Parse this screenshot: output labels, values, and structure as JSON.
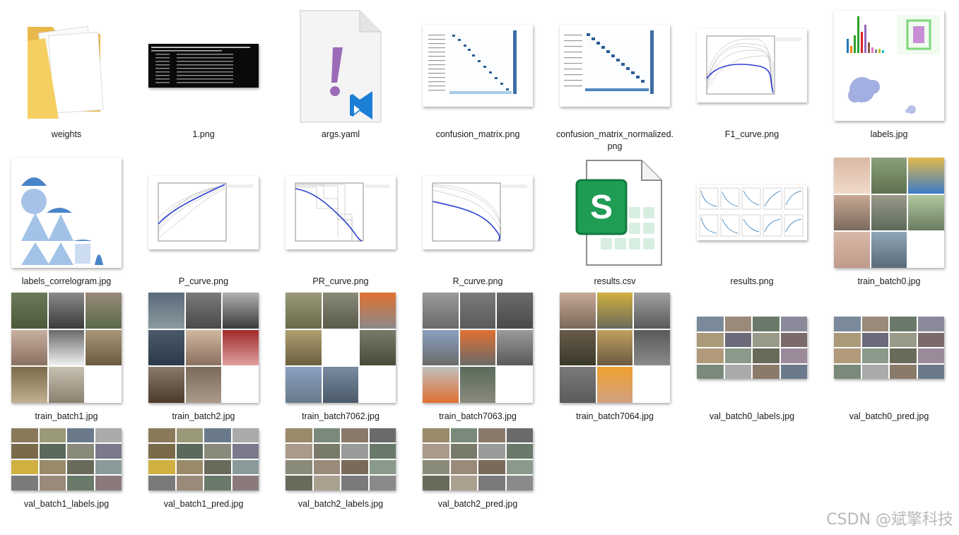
{
  "files": [
    {
      "name": "weights",
      "icon": "folder-icon"
    },
    {
      "name": "1.png",
      "icon": "terminal-image-icon"
    },
    {
      "name": "args.yaml",
      "icon": "yaml-file-icon"
    },
    {
      "name": "confusion_matrix.png",
      "icon": "confusion-matrix-thumb"
    },
    {
      "name": "confusion_matrix_normalized.png",
      "icon": "confusion-matrix-norm-thumb"
    },
    {
      "name": "F1_curve.png",
      "icon": "f1-curve-thumb"
    },
    {
      "name": "labels.jpg",
      "icon": "labels-thumb"
    },
    {
      "name": "labels_correlogram.jpg",
      "icon": "correlogram-thumb"
    },
    {
      "name": "P_curve.png",
      "icon": "p-curve-thumb"
    },
    {
      "name": "PR_curve.png",
      "icon": "pr-curve-thumb"
    },
    {
      "name": "R_curve.png",
      "icon": "r-curve-thumb"
    },
    {
      "name": "results.csv",
      "icon": "spreadsheet-file-icon"
    },
    {
      "name": "results.png",
      "icon": "results-thumb"
    },
    {
      "name": "train_batch0.jpg",
      "icon": "photo-grid-thumb"
    },
    {
      "name": "train_batch1.jpg",
      "icon": "photo-grid-thumb"
    },
    {
      "name": "train_batch2.jpg",
      "icon": "photo-grid-thumb"
    },
    {
      "name": "train_batch7062.jpg",
      "icon": "photo-grid-thumb"
    },
    {
      "name": "train_batch7063.jpg",
      "icon": "photo-grid-thumb"
    },
    {
      "name": "train_batch7064.jpg",
      "icon": "photo-grid-thumb"
    },
    {
      "name": "val_batch0_labels.jpg",
      "icon": "val-grid-thumb"
    },
    {
      "name": "val_batch0_pred.jpg",
      "icon": "val-grid-thumb"
    },
    {
      "name": "val_batch1_labels.jpg",
      "icon": "val-grid-thumb"
    },
    {
      "name": "val_batch1_pred.jpg",
      "icon": "val-grid-thumb"
    },
    {
      "name": "val_batch2_labels.jpg",
      "icon": "val-grid-thumb"
    },
    {
      "name": "val_batch2_pred.jpg",
      "icon": "val-grid-thumb"
    }
  ],
  "curve_titles": {
    "f1": "F1-Confidence Curve",
    "p": "Precision-Confidence Curve",
    "pr": "Precision-Recall Curve",
    "r": "Recall-Confidence Curve"
  },
  "colors": {
    "folder": "#f3c85a",
    "accent_blue": "#2c3fd1",
    "excel_green": "#1f9d55",
    "yaml_purple": "#9b6bb7"
  },
  "watermark": "CSDN @斌擎科技"
}
